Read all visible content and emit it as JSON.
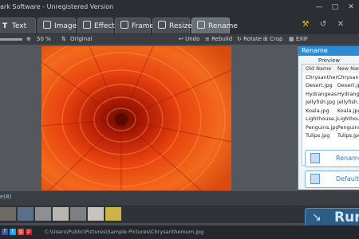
{
  "title": "ark Software - Unregistered Version",
  "window": {
    "icons": [
      "minimize-icon",
      "maximize-icon",
      "close-icon"
    ]
  },
  "tabs": [
    {
      "label": "Text",
      "icon": "text-icon",
      "active": false
    },
    {
      "label": "Image",
      "icon": "image-icon",
      "active": false
    },
    {
      "label": "Effect",
      "icon": "effect-icon",
      "active": false
    },
    {
      "label": "Frame",
      "icon": "frame-icon",
      "active": false
    },
    {
      "label": "Resize",
      "icon": "resize-icon",
      "active": false
    },
    {
      "label": "Rename",
      "icon": "rename-icon",
      "active": true
    }
  ],
  "toolbar": {
    "zoom": "50 %",
    "original": "Original",
    "undo": "Undo",
    "rebuild": "Rebuild",
    "rotate": "Rotate",
    "crop": "Crop",
    "exif": "EXIF"
  },
  "rename_panel": {
    "title": "Rename",
    "preview_label": "Preview",
    "columns": [
      "Old Name",
      "New Nam"
    ],
    "rows": [
      [
        "Chrysanthemum.jpg",
        "Chrysanthem"
      ],
      [
        "Desert.jpg",
        "Desert.jpg"
      ],
      [
        "Hydrangeas.jpg",
        "Hydrangeas"
      ],
      [
        "Jellyfish.jpg",
        "Jellyfish.jpg"
      ],
      [
        "Koala.jpg",
        "Koala.jpg"
      ],
      [
        "Lighthouse.jpg",
        "Lighthouse"
      ],
      [
        "Penguins.jpg",
        "Penguins.jpg"
      ],
      [
        "Tulips.jpg",
        "Tulips.jpg"
      ]
    ],
    "rename_button": "Rename",
    "default_button": "Default"
  },
  "gutter_label": "e(8)",
  "run_button": "Run",
  "status_path": "C:\\Users\\Public\\Pictures\\Sample Pictures\\Chrysanthemum.jpg",
  "colors": {
    "accent": "#2e8cd2",
    "bg": "#4a4d52",
    "run": "#2b5d86"
  }
}
